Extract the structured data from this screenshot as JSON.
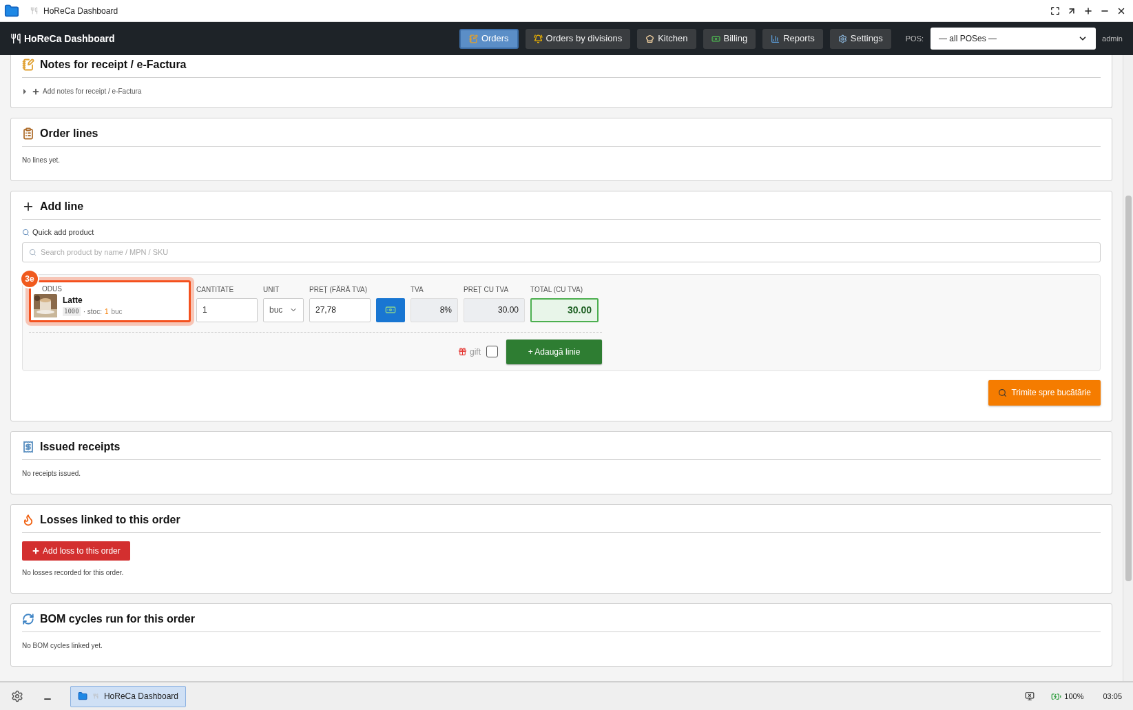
{
  "window": {
    "title": "HoReCa Dashboard"
  },
  "navbar": {
    "brand": "HoReCa Dashboard",
    "tabs": [
      {
        "label": "Orders",
        "selected": true
      },
      {
        "label": "Orders by divisions",
        "selected": false
      },
      {
        "label": "Kitchen",
        "selected": false
      },
      {
        "label": "Billing",
        "selected": false
      },
      {
        "label": "Reports",
        "selected": false
      },
      {
        "label": "Settings",
        "selected": false
      }
    ],
    "pos_label": "POS:",
    "pos_value": "— all POSes —",
    "user": "admin"
  },
  "sections": [
    {
      "kind": "notes",
      "title": "Notes for receipt / e-Factura",
      "toggle": "Add notes for receipt / e-Factura",
      "expanded": false
    },
    {
      "kind": "text",
      "title": "Order lines",
      "text": "No lines yet."
    },
    {
      "kind": "add_line",
      "title": "Add line",
      "quick_label": "Quick add product",
      "search_placeholder": "Search product by name / MPN / SKU",
      "marker": "3e",
      "product": {
        "label": "ODUS",
        "name": "Latte",
        "code": "1000",
        "stock_label": "· stoc:",
        "stock_qty": "1",
        "stock_unit": "buc"
      },
      "quantity": {
        "label": "CANTITATE",
        "value": "1"
      },
      "unit": {
        "label": "UNIT",
        "value": "buc"
      },
      "price": {
        "label": "PREȚ (FĂRĂ TVA)",
        "value": "27,78"
      },
      "tva": {
        "label": "TVA",
        "value": "8%"
      },
      "price_vat": {
        "label": "PREȚ CU TVA",
        "value": "30.00"
      },
      "total": {
        "label": "TOTAL (CU TVA)",
        "value": "30.00"
      },
      "gift": {
        "label": "gift",
        "checked": false
      },
      "add_button": "+ Adaugă linie",
      "send_button": "Trimite spre bucătărie"
    },
    {
      "kind": "text",
      "title": "Issued receipts",
      "text": "No receipts issued."
    },
    {
      "kind": "losses",
      "title": "Losses linked to this order",
      "button": "Add loss to this order",
      "text": "No losses recorded for this order."
    },
    {
      "kind": "text",
      "title": "BOM cycles run for this order",
      "text": "No BOM cycles linked yet."
    }
  ],
  "taskbar": {
    "task": "HoReCa Dashboard",
    "battery": "100%",
    "time": "03:05"
  }
}
